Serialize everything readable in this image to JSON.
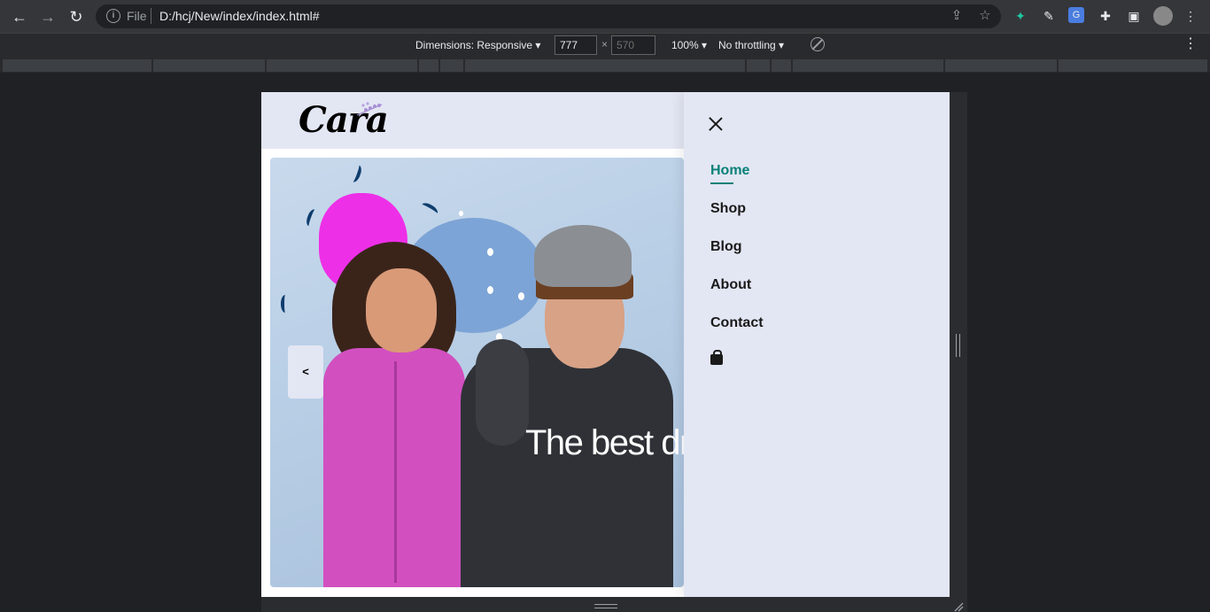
{
  "browser": {
    "scheme_label": "File",
    "url": "D:/hcj/New/index/index.html#"
  },
  "devtools": {
    "dimensions_label": "Dimensions: Responsive",
    "width_value": "777",
    "height_value": "570",
    "zoom_label": "100%",
    "throttle_label": "No throttling",
    "times": "×"
  },
  "site": {
    "logo": "Cara",
    "hero_text": "The best dr",
    "prev_label": "<",
    "nav": {
      "items": [
        {
          "label": "Home",
          "active": true
        },
        {
          "label": "Shop",
          "active": false
        },
        {
          "label": "Blog",
          "active": false
        },
        {
          "label": "About",
          "active": false
        },
        {
          "label": "Contact",
          "active": false
        }
      ],
      "cart_icon": "shopping-bag-icon"
    },
    "accent": "#088178",
    "header_bg": "#e3e6f3"
  }
}
